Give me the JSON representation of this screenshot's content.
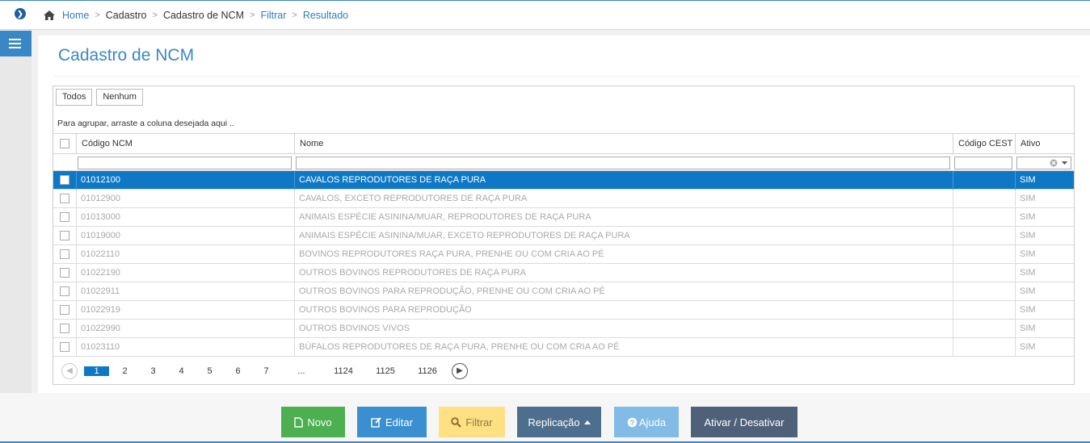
{
  "breadcrumb": {
    "home": "Home",
    "cadastro": "Cadastro",
    "cadastro_ncm": "Cadastro de NCM",
    "filtrar": "Filtrar",
    "resultado": "Resultado"
  },
  "page": {
    "title": "Cadastro de NCM"
  },
  "toolbar": {
    "todos": "Todos",
    "nenhum": "Nenhum"
  },
  "grid": {
    "group_hint": "Para agrupar, arraste a coluna desejada aqui ..",
    "columns": {
      "codigo": "Código NCM",
      "nome": "Nome",
      "cest": "Código CEST",
      "ativo": "Ativo"
    },
    "rows": [
      {
        "codigo": "01012100",
        "nome": "CAVALOS REPRODUTORES DE RAÇA PURA",
        "cest": "",
        "ativo": "SIM"
      },
      {
        "codigo": "01012900",
        "nome": "CAVALOS, EXCETO REPRODUTORES DE RAÇA PURA",
        "cest": "",
        "ativo": "SIM"
      },
      {
        "codigo": "01013000",
        "nome": "ANIMAIS ESPÉCIE ASININA/MUAR, REPRODUTORES DE RAÇA PURA",
        "cest": "",
        "ativo": "SIM"
      },
      {
        "codigo": "01019000",
        "nome": "ANIMAIS ESPÉCIE ASININA/MUAR, EXCETO REPRODUTORES DE RAÇA PURA",
        "cest": "",
        "ativo": "SIM"
      },
      {
        "codigo": "01022110",
        "nome": "BOVINOS REPRODUTORES RAÇA PURA, PRENHE OU COM CRIA AO PÉ",
        "cest": "",
        "ativo": "SIM"
      },
      {
        "codigo": "01022190",
        "nome": "OUTROS BOVINOS REPRODUTORES DE RAÇA PURA",
        "cest": "",
        "ativo": "SIM"
      },
      {
        "codigo": "01022911",
        "nome": "OUTROS BOVINOS PARA REPRODUÇÃO, PRENHE OU COM CRIA AO PÉ",
        "cest": "",
        "ativo": "SIM"
      },
      {
        "codigo": "01022919",
        "nome": "OUTROS BOVINOS PARA REPRODUÇÃO",
        "cest": "",
        "ativo": "SIM"
      },
      {
        "codigo": "01022990",
        "nome": "OUTROS BOVINOS VIVOS",
        "cest": "",
        "ativo": "SIM"
      },
      {
        "codigo": "01023110",
        "nome": "BÚFALOS REPRODUTORES DE RAÇA PURA, PRENHE OU COM CRIA AO PÉ",
        "cest": "",
        "ativo": "SIM"
      }
    ],
    "selected_row": 0
  },
  "pager": {
    "pages": [
      "1",
      "2",
      "3",
      "4",
      "5",
      "6",
      "7",
      "...",
      "1124",
      "1125",
      "1126"
    ],
    "current": "1"
  },
  "actions": {
    "novo": "Novo",
    "editar": "Editar",
    "filtrar": "Filtrar",
    "replicacao": "Replicação",
    "ajuda": "Ajuda",
    "ativar": "Ativar / Desativar"
  },
  "colors": {
    "accent": "#3a87c5",
    "selection": "#0e78c6",
    "novo": "#4caf50",
    "editar": "#3a8fd0",
    "filtrar": "#ffe082",
    "replicacao": "#4e6e8e",
    "ajuda": "#82bbe6",
    "ativar": "#4e6178"
  }
}
